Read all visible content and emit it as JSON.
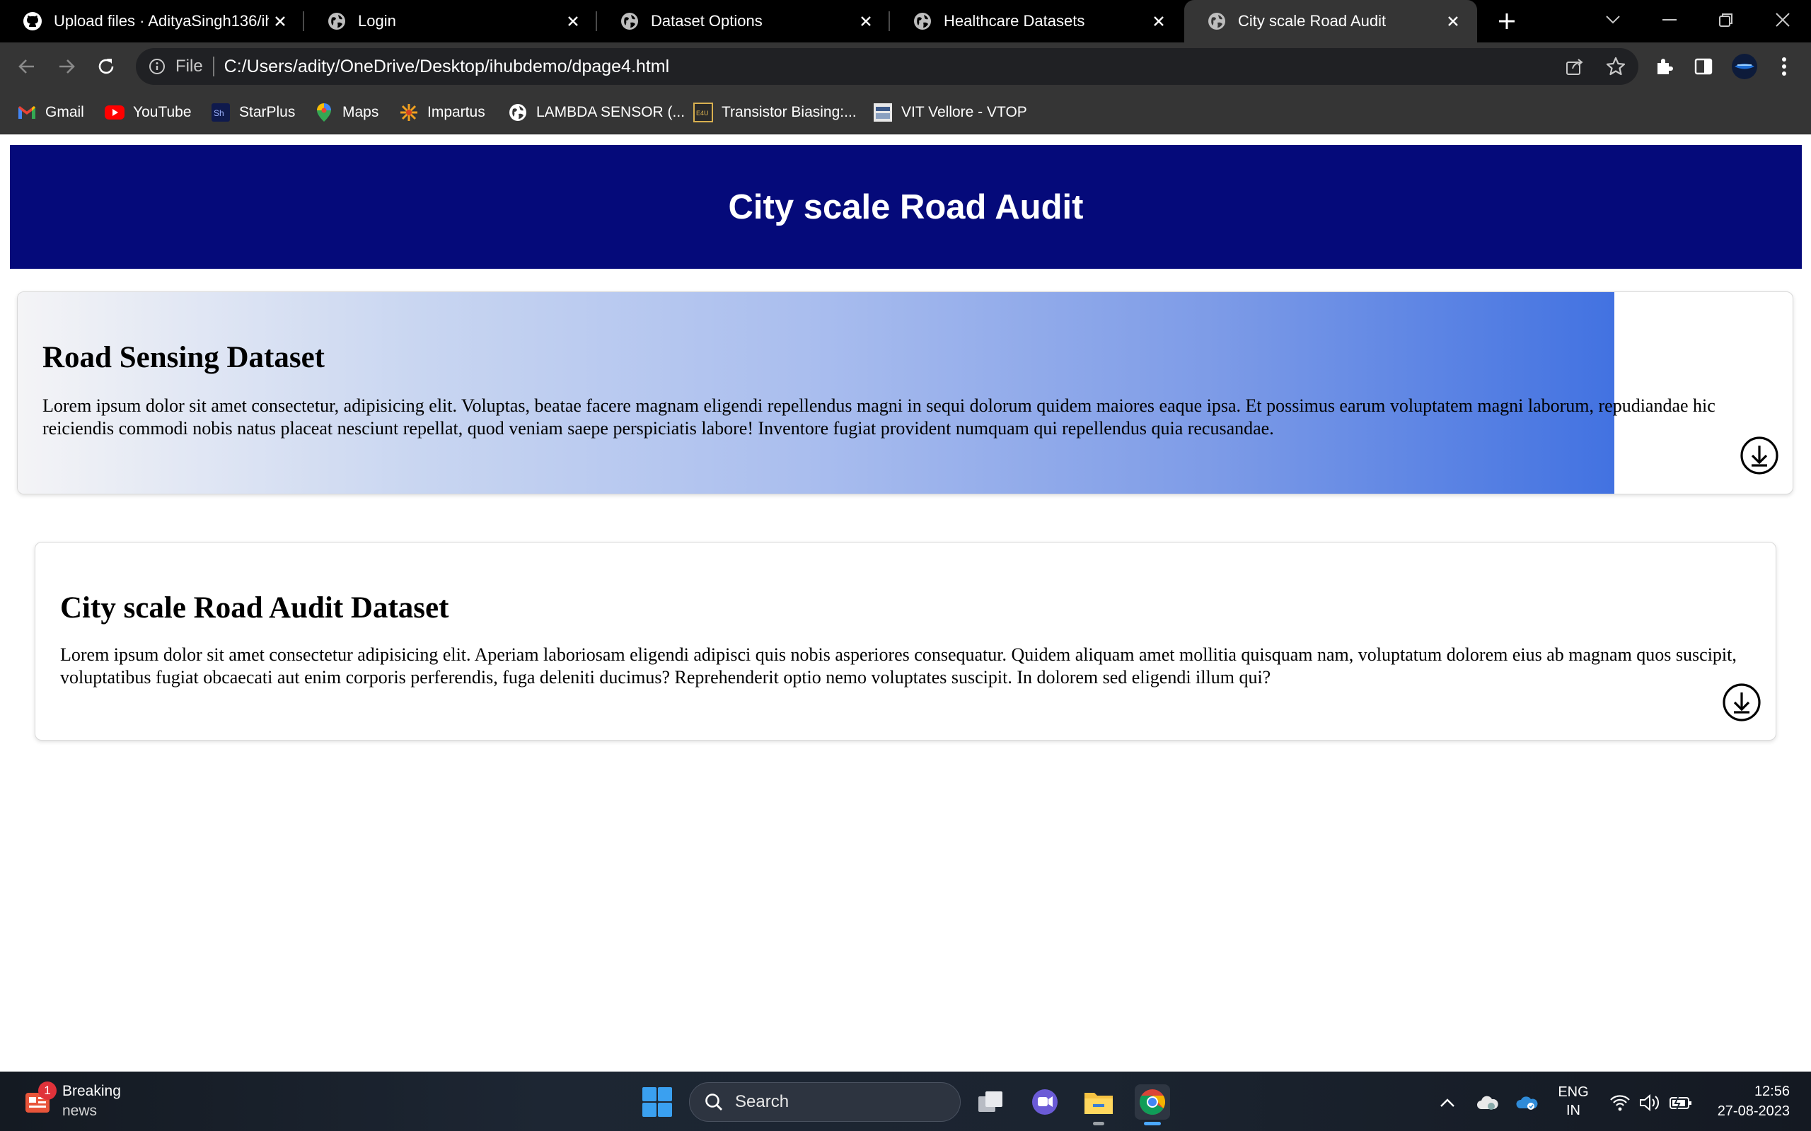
{
  "browser": {
    "tabs": [
      {
        "title": "Upload files · AdityaSingh136/ihu",
        "icon": "github-icon",
        "active": false
      },
      {
        "title": "Login",
        "icon": "globe-icon",
        "active": false
      },
      {
        "title": "Dataset Options",
        "icon": "globe-icon",
        "active": false
      },
      {
        "title": "Healthcare Datasets",
        "icon": "globe-icon",
        "active": false
      },
      {
        "title": "City scale Road Audit",
        "icon": "globe-icon",
        "active": true
      }
    ],
    "address": {
      "scheme": "File",
      "url": "C:/Users/adity/OneDrive/Desktop/ihubdemo/dpage4.html"
    },
    "bookmarks": [
      {
        "label": "Gmail",
        "icon": "gmail-icon"
      },
      {
        "label": "YouTube",
        "icon": "youtube-icon"
      },
      {
        "label": "StarPlus",
        "icon": "starplus-icon"
      },
      {
        "label": "Maps",
        "icon": "maps-icon"
      },
      {
        "label": "Impartus",
        "icon": "impartus-icon"
      },
      {
        "label": "LAMBDA SENSOR (...",
        "icon": "globe-icon"
      },
      {
        "label": "Transistor Biasing:...",
        "icon": "e4u-icon"
      },
      {
        "label": "VIT Vellore - VTOP",
        "icon": "vtop-icon"
      }
    ]
  },
  "page": {
    "header_title": "City scale Road Audit",
    "cards": [
      {
        "title": "Road Sensing Dataset",
        "text": "Lorem ipsum dolor sit amet consectetur, adipisicing elit. Voluptas, beatae facere magnam eligendi repellendus magni in sequi dolorum quidem maiores eaque ipsa. Et possimus earum voluptatem magni laborum, repudiandae hic reiciendis commodi nobis natus placeat nesciunt repellat, quod veniam saepe perspiciatis labore! Inventore fugiat provident numquam qui repellendus quia recusandae.",
        "action_icon": "download-icon",
        "hovered": true
      },
      {
        "title": "City scale Road Audit Dataset",
        "text": "Lorem ipsum dolor sit amet consectetur adipisicing elit. Aperiam laboriosam eligendi adipisci quis nobis asperiores consequatur. Quidem aliquam amet mollitia quisquam nam, voluptatum dolorem eius ab magnam quos suscipit, voluptatibus fugiat obcaecati aut enim corporis perferendis, fuga deleniti ducimus? Reprehenderit optio nemo voluptates suscipit. In dolorem sed eligendi illum qui?",
        "action_icon": "download-icon",
        "hovered": false
      }
    ],
    "colors": {
      "header_bg": "#050a7a",
      "gradient_start": "#f4f4f6",
      "gradient_end": "#4272e1"
    }
  },
  "taskbar": {
    "news": {
      "badge": "1",
      "line1": "Breaking",
      "line2": "news"
    },
    "search_label": "Search",
    "language": {
      "line1": "ENG",
      "line2": "IN"
    },
    "time": "12:56",
    "date": "27-08-2023"
  }
}
